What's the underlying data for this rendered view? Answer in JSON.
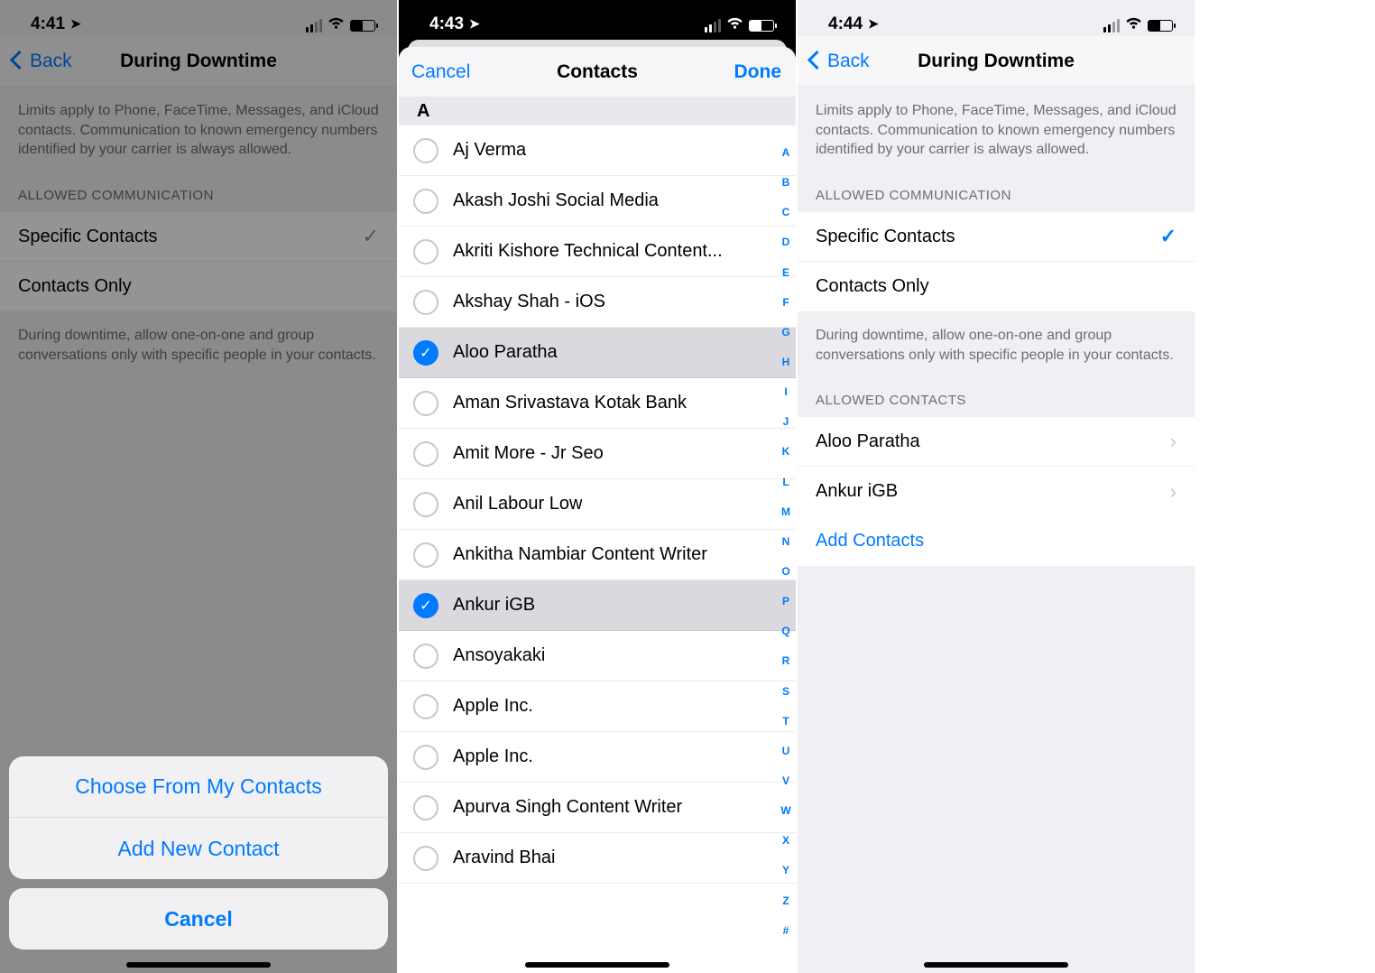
{
  "phone1": {
    "status": {
      "time": "4:41",
      "location_icon": "➤"
    },
    "nav": {
      "back": "Back",
      "title": "During Downtime"
    },
    "note": "Limits apply to Phone, FaceTime, Messages, and iCloud contacts. Communication to known emergency numbers identified by your carrier is always allowed.",
    "section_allowed": "ALLOWED COMMUNICATION",
    "options": {
      "specific": "Specific Contacts",
      "contacts_only": "Contacts Only"
    },
    "footer": "During downtime, allow one-on-one and group conversations only with specific people in your contacts.",
    "sheet": {
      "choose": "Choose From My Contacts",
      "addnew": "Add New Contact",
      "cancel": "Cancel"
    }
  },
  "phone2": {
    "status": {
      "time": "4:43",
      "location_icon": "➤"
    },
    "nav": {
      "cancel": "Cancel",
      "title": "Contacts",
      "done": "Done"
    },
    "letter": "A",
    "contacts": [
      {
        "name": "Aj Verma",
        "selected": false
      },
      {
        "name": "Akash Joshi Social Media",
        "selected": false
      },
      {
        "name": "Akriti Kishore Technical Content...",
        "selected": false
      },
      {
        "name": "Akshay Shah - iOS",
        "selected": false
      },
      {
        "name": "Aloo Paratha",
        "selected": true
      },
      {
        "name": "Aman Srivastava Kotak Bank",
        "selected": false
      },
      {
        "name": "Amit More - Jr Seo",
        "selected": false
      },
      {
        "name": "Anil Labour Low",
        "selected": false
      },
      {
        "name": "Ankitha Nambiar Content Writer",
        "selected": false
      },
      {
        "name": "Ankur iGB",
        "selected": true
      },
      {
        "name": "Ansoyakaki",
        "selected": false
      },
      {
        "name": "Apple Inc.",
        "selected": false
      },
      {
        "name": "Apple Inc.",
        "selected": false
      },
      {
        "name": "Apurva Singh Content Writer",
        "selected": false
      },
      {
        "name": "Aravind Bhai",
        "selected": false
      }
    ],
    "index": [
      "A",
      "B",
      "C",
      "D",
      "E",
      "F",
      "G",
      "H",
      "I",
      "J",
      "K",
      "L",
      "M",
      "N",
      "O",
      "P",
      "Q",
      "R",
      "S",
      "T",
      "U",
      "V",
      "W",
      "X",
      "Y",
      "Z",
      "#"
    ]
  },
  "phone3": {
    "status": {
      "time": "4:44",
      "location_icon": "➤"
    },
    "nav": {
      "back": "Back",
      "title": "During Downtime"
    },
    "note": "Limits apply to Phone, FaceTime, Messages, and iCloud contacts. Communication to known emergency numbers identified by your carrier is always allowed.",
    "section_allowed": "ALLOWED COMMUNICATION",
    "options": {
      "specific": "Specific Contacts",
      "contacts_only": "Contacts Only"
    },
    "footer": "During downtime, allow one-on-one and group conversations only with specific people in your contacts.",
    "section_contacts": "ALLOWED CONTACTS",
    "allowed": [
      {
        "name": "Aloo Paratha"
      },
      {
        "name": "Ankur iGB"
      }
    ],
    "add": "Add Contacts"
  }
}
